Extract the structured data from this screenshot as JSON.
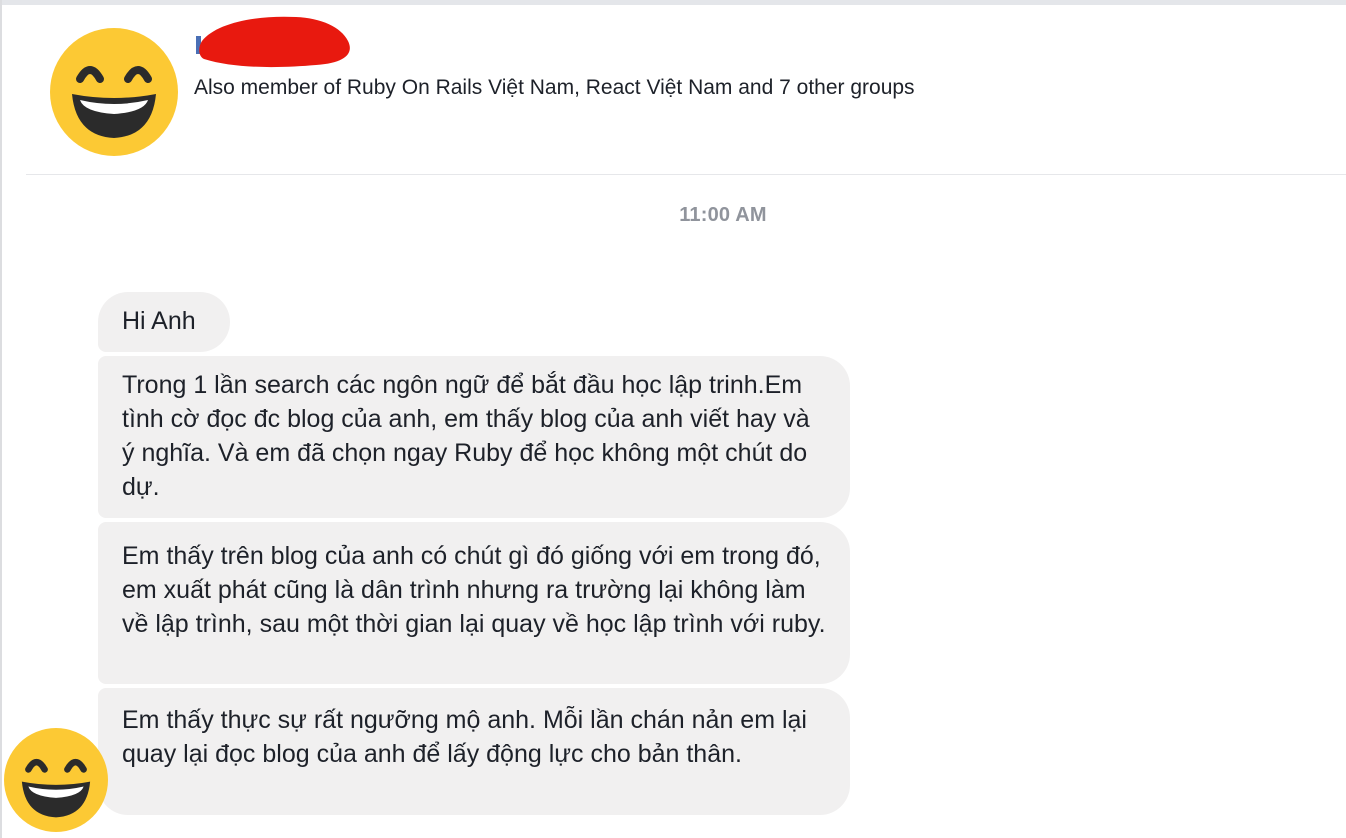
{
  "header": {
    "membership_text": "Also member of Ruby On Rails Việt Nam, React Việt Nam and 7 other groups"
  },
  "conversation": {
    "timestamp": "11:00 AM",
    "messages": [
      {
        "text": "Hi Anh"
      },
      {
        "text": "Trong 1 lần search các ngôn ngữ để  bắt đầu học lập trinh.Em tình cờ đọc đc blog của anh, em thấy blog của anh viết hay  và ý nghĩa. Và em đã chọn ngay Ruby để học không một chút do dự."
      },
      {
        "text": "Em thấy trên blog của anh có chút gì đó giống với em trong đó, em xuất phát cũng là dân trình nhưng ra trường lại không làm về lập trình, sau một thời gian lại quay về học lập trình với ruby."
      },
      {
        "text": "Em thấy thực sự rất ngưỡng mộ  anh. Mỗi lần chán nản em lại quay lại đọc blog của anh để lấy động lực cho bản thân."
      }
    ]
  },
  "icons": {
    "profile_avatar": "grinning-face-with-smiling-eyes-icon",
    "sender_avatar": "grinning-face-with-smiling-eyes-icon",
    "redaction": "red-scribble-redaction"
  },
  "colors": {
    "bubble_bg": "#f1f0f0",
    "emoji_face": "#fcc934",
    "redaction_red": "#e8190f",
    "timestamp_gray": "#90949c"
  }
}
